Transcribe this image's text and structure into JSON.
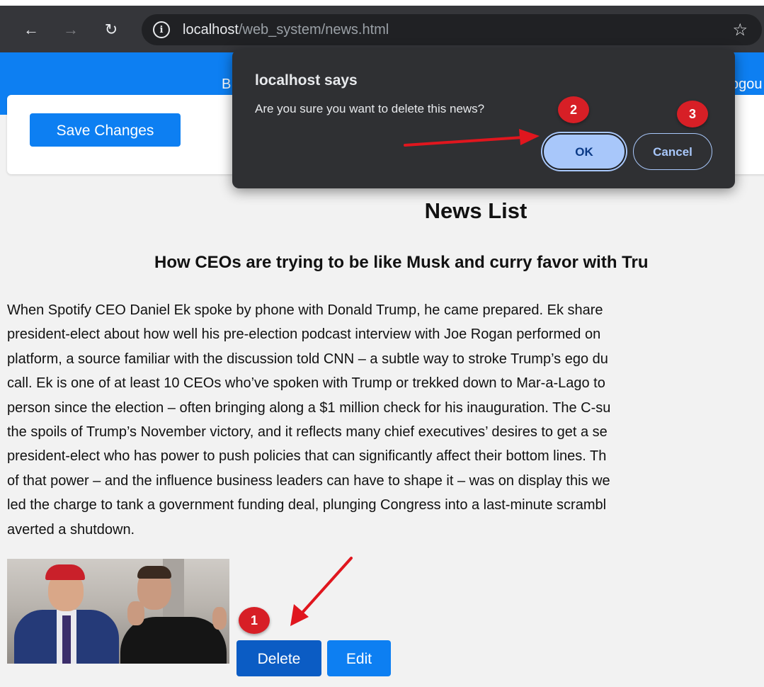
{
  "browser": {
    "back_icon": "arrow-left-icon",
    "forward_icon": "arrow-right-icon",
    "reload_icon": "reload-icon",
    "info_icon": "info-icon",
    "bookmark_icon": "star-icon",
    "url_host": "localhost",
    "url_path": "/web_system/news.html"
  },
  "navbar": {
    "left_text": "B",
    "right_text": "ogou",
    "color": "#0d7ff2"
  },
  "form": {
    "save_label": "Save Changes"
  },
  "news": {
    "list_title": "News List",
    "article_title": "How CEOs are trying to be like Musk and curry favor with Tru",
    "body_lines": [
      "When Spotify CEO Daniel Ek spoke by phone with Donald Trump, he came prepared. Ek share",
      "president-elect about how well his pre-election podcast interview with Joe Rogan performed on",
      "platform, a source familiar with the discussion told CNN – a subtle way to stroke Trump’s ego du",
      "call. Ek is one of at least 10 CEOs who’ve spoken with Trump or trekked down to Mar-a-Lago to",
      "person since the election – often bringing along a $1 million check for his inauguration. The C-su",
      "the spoils of Trump’s November victory, and it reflects many chief executives’ desires to get a se",
      "president-elect who has power to push policies that can significantly affect their bottom lines. Th",
      "of that power – and the influence business leaders can have to shape it – was on display this we",
      "led the charge to tank a government funding deal, plunging Congress into a last-minute scrambl",
      "averted a shutdown."
    ],
    "delete_label": "Delete",
    "edit_label": "Edit"
  },
  "dialog": {
    "title": "localhost says",
    "message": "Are you sure you want to delete this news?",
    "ok_label": "OK",
    "cancel_label": "Cancel"
  },
  "annotations": {
    "badges": [
      "1",
      "2",
      "3"
    ],
    "color": "#d71f26"
  }
}
